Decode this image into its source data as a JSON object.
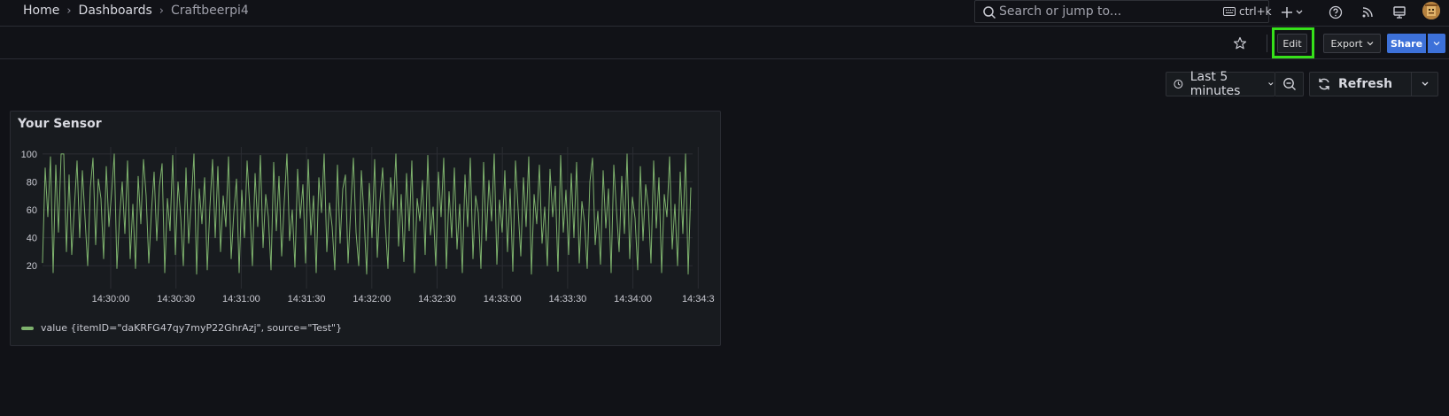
{
  "breadcrumb": {
    "home": "Home",
    "dashboards": "Dashboards",
    "current": "Craftbeerpi4",
    "separator": "›"
  },
  "search": {
    "placeholder": "Search or jump to...",
    "shortcut": "ctrl+k"
  },
  "toolbar": {
    "edit_label": "Edit",
    "export_label": "Export",
    "share_label": "Share"
  },
  "time": {
    "range_label": "Last 5 minutes",
    "refresh_label": "Refresh"
  },
  "panel": {
    "title": "Your Sensor"
  },
  "colors": {
    "series": "#7eb26d",
    "highlight": "#36e01a",
    "share": "#3d71d9"
  },
  "chart_data": {
    "type": "line",
    "ylim": [
      10,
      105
    ],
    "y_ticks": [
      20,
      40,
      60,
      80,
      100
    ],
    "x_tick_labels": [
      "14:30:00",
      "14:30:30",
      "14:31:00",
      "14:31:30",
      "14:32:00",
      "14:32:30",
      "14:33:00",
      "14:33:30",
      "14:34:00",
      "14:34:3"
    ],
    "grid": true,
    "legend_position": "bottom-left",
    "series": [
      {
        "name": "value {itemID=\"daKRFG47qy7myP22GhrAzj\", source=\"Test\"}",
        "values": [
          22,
          90,
          55,
          98,
          15,
          92,
          44,
          100,
          100,
          30,
          85,
          28,
          62,
          95,
          40,
          88,
          54,
          20,
          76,
          97,
          35,
          82,
          68,
          25,
          91,
          48,
          72,
          100,
          18,
          55,
          80,
          43,
          95,
          25,
          64,
          18,
          84,
          50,
          96,
          70,
          22,
          59,
          87,
          38,
          77,
          93,
          15,
          68,
          45,
          99,
          28,
          80,
          55,
          20,
          90,
          36,
          66,
          100,
          14,
          75,
          50,
          83,
          17,
          62,
          96,
          40,
          91,
          30,
          70,
          48,
          98,
          25,
          58,
          82,
          15,
          74,
          40,
          95,
          62,
          20,
          86,
          48,
          99,
          33,
          71,
          55,
          17,
          94,
          45,
          84,
          27,
          66,
          100,
          38,
          60,
          19,
          89,
          54,
          78,
          22,
          96,
          42,
          70,
          15,
          83,
          58,
          100,
          30,
          65,
          48,
          17,
          92,
          36,
          75,
          85,
          22,
          61,
          97,
          44,
          20,
          88,
          55,
          14,
          79,
          40,
          96,
          26,
          66,
          90,
          50,
          18,
          83,
          60,
          100,
          34,
          71,
          23,
          86,
          45,
          95,
          15,
          68,
          52,
          81,
          28,
          99,
          42,
          62,
          20,
          87,
          55,
          97,
          18,
          73,
          40,
          90,
          32,
          64,
          15,
          85,
          48,
          97,
          25,
          70,
          58,
          18,
          94,
          38,
          81,
          52,
          100,
          21,
          67,
          44,
          88,
          30,
          75,
          16,
          95,
          60,
          27,
          83,
          48,
          98,
          14,
          71,
          50,
          92,
          36,
          62,
          20,
          89,
          55,
          77,
          16,
          99,
          44,
          74,
          28,
          86,
          40,
          94,
          22,
          66,
          51,
          18,
          80,
          97,
          35,
          59,
          21,
          88,
          47,
          75,
          15,
          92,
          60,
          30,
          84,
          43,
          100,
          25,
          69,
          54,
          17,
          91,
          38,
          78,
          62,
          22,
          95,
          47,
          83,
          15,
          71,
          55,
          98,
          32,
          64,
          20,
          87,
          43,
          100,
          14,
          76
        ]
      }
    ]
  }
}
